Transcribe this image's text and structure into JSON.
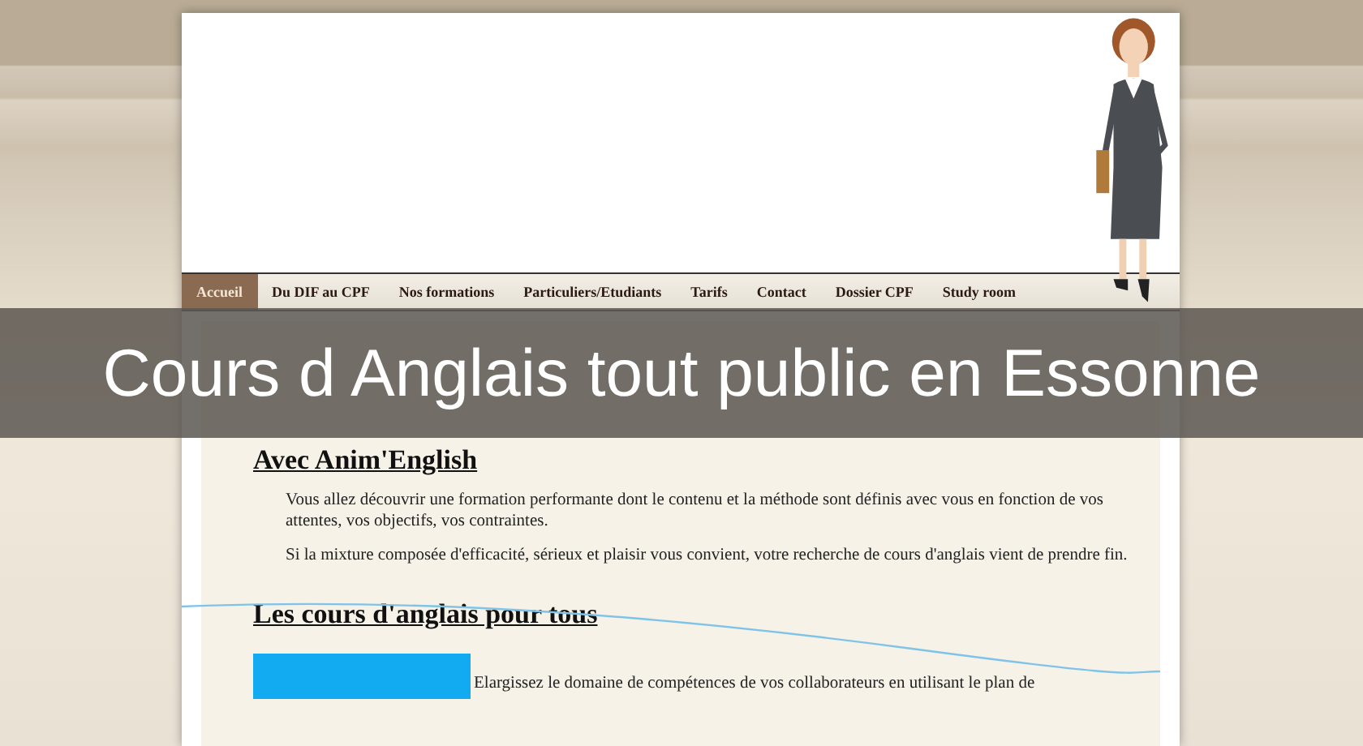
{
  "nav": [
    {
      "label": "Accueil",
      "selected": true
    },
    {
      "label": "Du DIF au CPF",
      "selected": false
    },
    {
      "label": "Nos formations",
      "selected": false
    },
    {
      "label": "Particuliers/Etudiants",
      "selected": false
    },
    {
      "label": "Tarifs",
      "selected": false
    },
    {
      "label": "Contact",
      "selected": false
    },
    {
      "label": "Dossier CPF",
      "selected": false
    },
    {
      "label": "Study room",
      "selected": false
    }
  ],
  "banner": {
    "title": "Cours d Anglais tout public en Essonne"
  },
  "sections": [
    {
      "heading": "Avec Anim'English",
      "paragraphs": [
        "Vous allez découvrir une formation performante dont le contenu et la méthode sont définis avec vous en fonction de vos attentes, vos objectifs, vos contraintes.",
        "Si la mixture composée d'efficacité, sérieux et plaisir vous convient, votre recherche de cours d'anglais vient de prendre fin."
      ]
    },
    {
      "heading": "Les cours d'anglais pour tous",
      "paragraphs": [
        "Elargissez le domaine de compétences de vos collaborateurs en utilisant le plan de"
      ]
    }
  ]
}
